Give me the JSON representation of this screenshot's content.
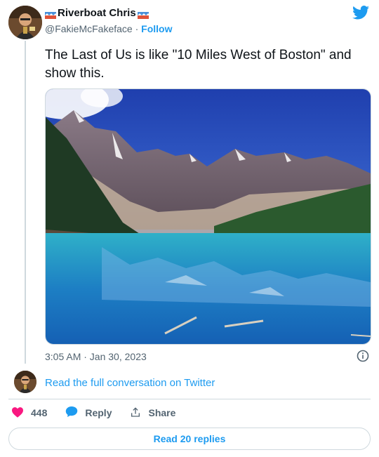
{
  "author": {
    "name": "Riverboat Chris",
    "handle": "@FakieMcFakeface",
    "follow_label": "Follow",
    "separator": "·"
  },
  "tweet": {
    "text": "The Last of Us is like \"10 Miles West of Boston\" and show this.",
    "timestamp": "3:05 AM · Jan 30, 2023"
  },
  "footer": {
    "read_full": "Read the full conversation on Twitter",
    "likes_count": "448",
    "reply_label": "Reply",
    "share_label": "Share",
    "read_replies": "Read 20 replies"
  },
  "icons": {
    "brand": "twitter-bird-icon",
    "like": "heart-icon",
    "reply": "speech-bubble-icon",
    "share": "share-icon",
    "info": "info-icon"
  },
  "colors": {
    "accent": "#1d9bf0",
    "like": "#f91880",
    "text": "#0f1419",
    "muted": "#536471",
    "border": "#cfd9de"
  }
}
